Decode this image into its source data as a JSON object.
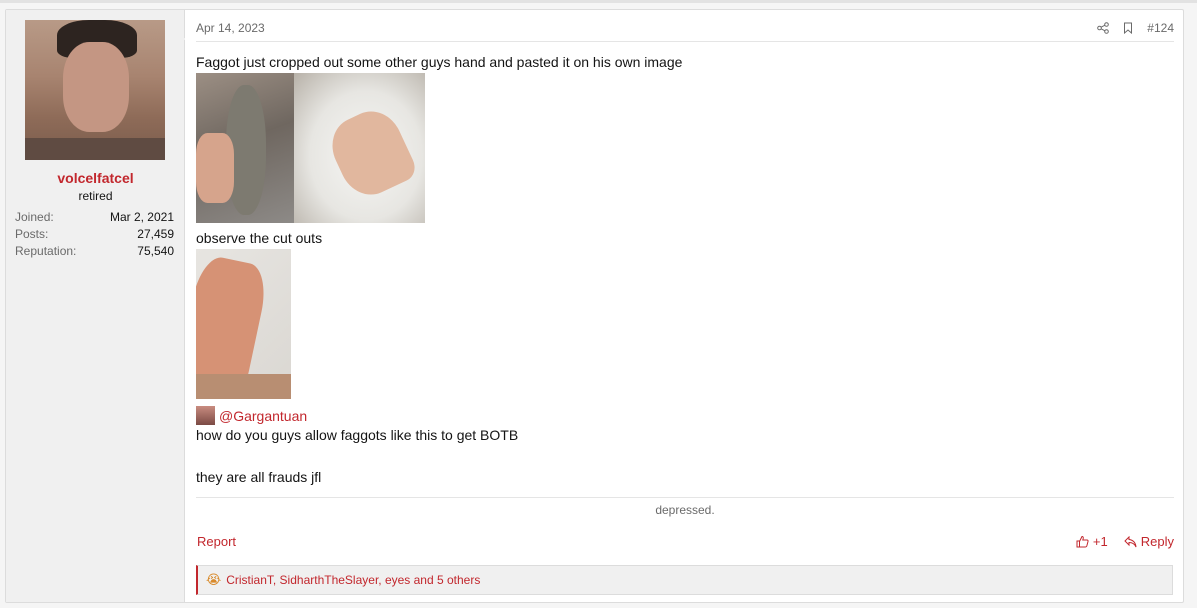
{
  "post": {
    "date": "Apr 14, 2023",
    "number": "#124",
    "paragraphs": [
      "Faggot just cropped out some other guys hand and pasted it on his own image",
      "observe the cut outs"
    ],
    "mention": "@Gargantuan",
    "body_after_mention": [
      "how do you guys allow faggots like this to get BOTB",
      "they are all frauds jfl"
    ],
    "signature": "depressed."
  },
  "user": {
    "name": "volcelfatcel",
    "title": "retired",
    "stats": [
      {
        "label": "Joined:",
        "value": "Mar 2, 2021"
      },
      {
        "label": "Posts:",
        "value": "27,459"
      },
      {
        "label": "Reputation:",
        "value": "75,540"
      }
    ]
  },
  "actions": {
    "report": "Report",
    "like_count": "+1",
    "reply": "Reply",
    "share_icon": "share-icon",
    "bookmark_icon": "bookmark-icon"
  },
  "reactions": {
    "emoji": "😭",
    "summary": "CristianT, SidharthTheSlayer, eyes and 5 others"
  },
  "colors": {
    "accent": "#c2272d",
    "muted": "#6a6a6a"
  }
}
